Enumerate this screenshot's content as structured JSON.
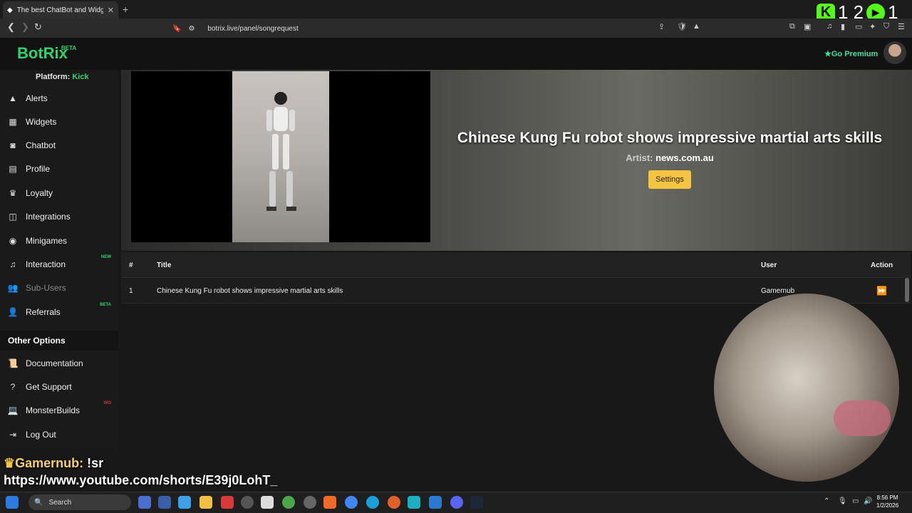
{
  "browser": {
    "tab_title": "The best ChatBot and Widge",
    "url": "botrix.live/panel/songrequest",
    "overlay_numbers": "1 2",
    "overlay_count": "1"
  },
  "header": {
    "logo": "BotRix",
    "logo_badge": "BETA",
    "premium_label": "Go Premium"
  },
  "sidebar": {
    "platform_label": "Platform:",
    "platform_value": "Kick",
    "items": [
      {
        "label": "Alerts",
        "icon": "warning-icon"
      },
      {
        "label": "Widgets",
        "icon": "grid-icon"
      },
      {
        "label": "Chatbot",
        "icon": "robot-icon"
      },
      {
        "label": "Profile",
        "icon": "id-card-icon"
      },
      {
        "label": "Loyalty",
        "icon": "trophy-icon"
      },
      {
        "label": "Integrations",
        "icon": "plug-icon"
      },
      {
        "label": "Minigames",
        "icon": "gamepad-icon"
      },
      {
        "label": "Interaction",
        "icon": "music-icon",
        "badge": "NEW"
      },
      {
        "label": "Sub-Users",
        "icon": "users-icon"
      },
      {
        "label": "Referrals",
        "icon": "user-group-icon",
        "badge": "BETA"
      }
    ],
    "other_heading": "Other Options",
    "other_items": [
      {
        "label": "Documentation",
        "icon": "book-icon"
      },
      {
        "label": "Get Support",
        "icon": "question-icon"
      },
      {
        "label": "MonsterBuilds",
        "icon": "laptop-icon",
        "badge": "WO"
      },
      {
        "label": "Log Out",
        "icon": "logout-icon"
      }
    ]
  },
  "now_playing": {
    "title": "Chinese Kung Fu robot shows impressive martial arts skills",
    "artist_label": "Artist:",
    "artist": "news.com.au",
    "settings_label": "Settings"
  },
  "queue": {
    "headers": {
      "num": "#",
      "title": "Title",
      "user": "User",
      "action": "Action"
    },
    "rows": [
      {
        "num": "1",
        "title": "Chinese Kung Fu robot shows impressive martial arts skills",
        "user": "Gamernub"
      }
    ]
  },
  "chat_overlay": {
    "name": "Gamernub:",
    "command": "!sr",
    "link": "https://www.youtube.com/shorts/E39j0LohT_"
  },
  "taskbar": {
    "search_label": "Search",
    "time": "8:56 PM",
    "date": "1/2/2026"
  },
  "colors": {
    "accent_green": "#2fd36e",
    "settings_yellow": "#f5c542",
    "kick_green": "#53fc18"
  }
}
